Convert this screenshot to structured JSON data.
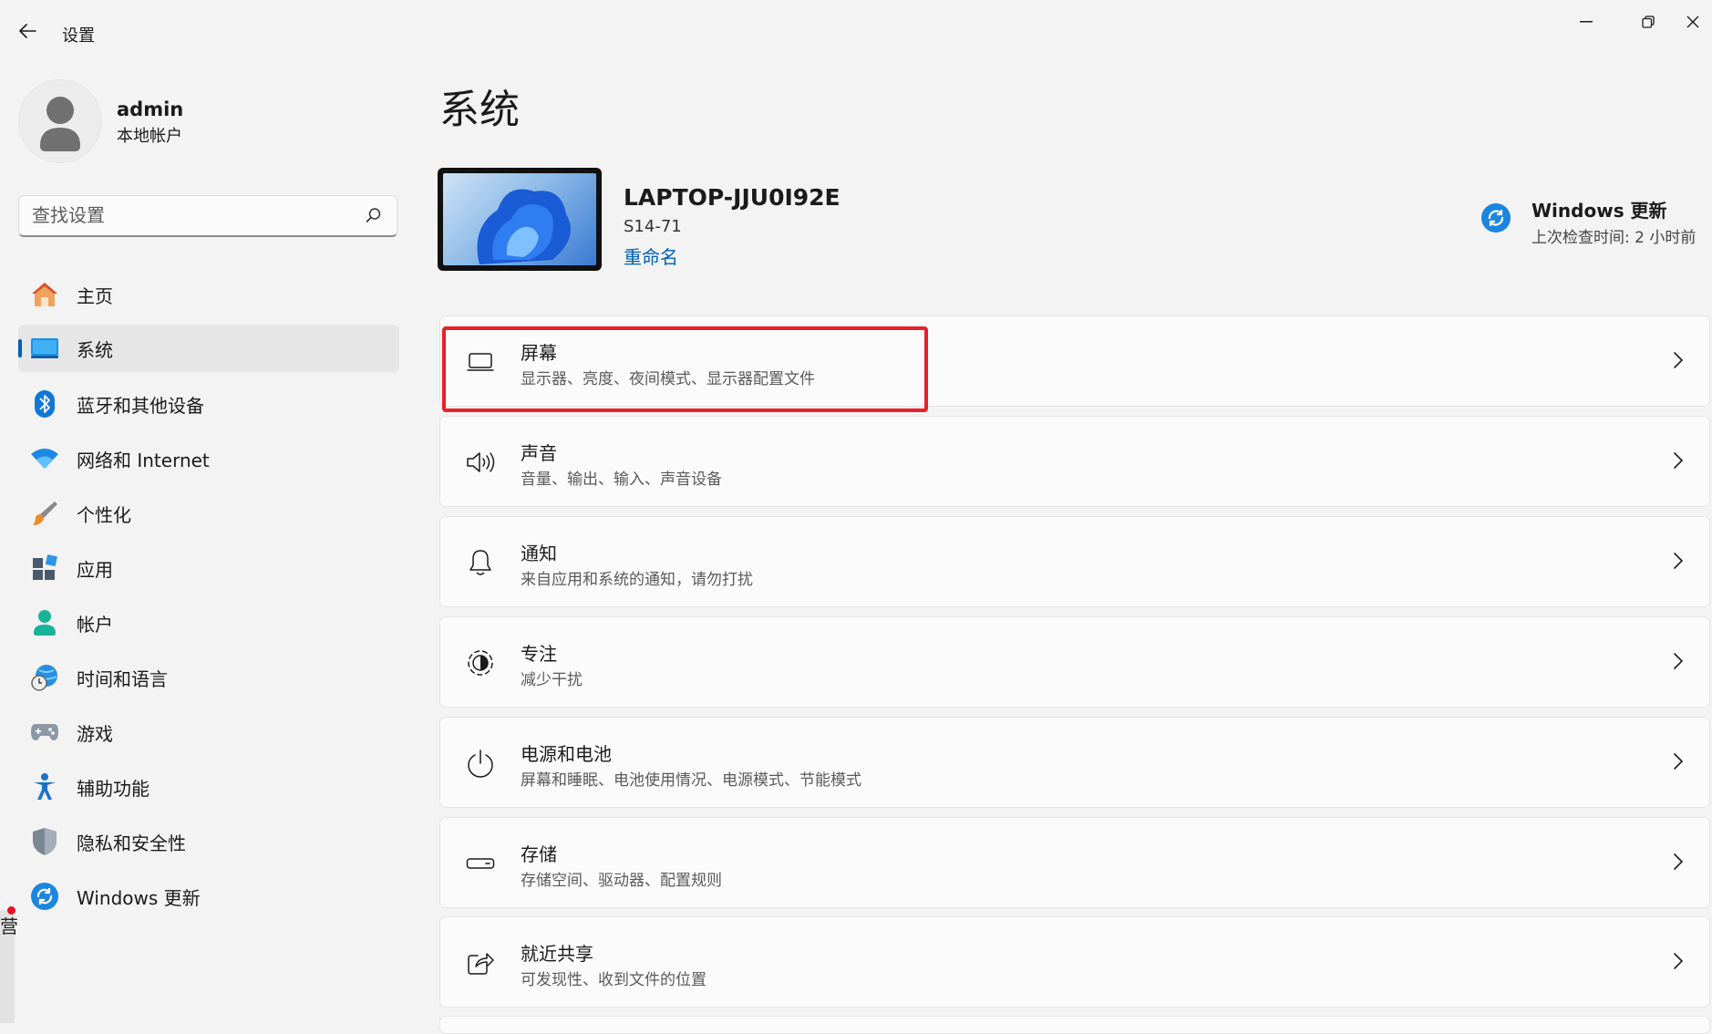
{
  "window": {
    "title": "设置",
    "controls": [
      "minimize-icon",
      "restore-icon",
      "close-icon"
    ]
  },
  "account": {
    "name": "admin",
    "type": "本地帐户"
  },
  "search": {
    "placeholder": "查找设置"
  },
  "sidebar": {
    "items": [
      {
        "label": "主页",
        "icon": "home-icon",
        "active": false
      },
      {
        "label": "系统",
        "icon": "system-icon",
        "active": true
      },
      {
        "label": "蓝牙和其他设备",
        "icon": "bluetooth-icon",
        "active": false
      },
      {
        "label": "网络和 Internet",
        "icon": "wifi-icon",
        "active": false
      },
      {
        "label": "个性化",
        "icon": "brush-icon",
        "active": false
      },
      {
        "label": "应用",
        "icon": "apps-icon",
        "active": false
      },
      {
        "label": "帐户",
        "icon": "account-icon",
        "active": false
      },
      {
        "label": "时间和语言",
        "icon": "time-language-icon",
        "active": false
      },
      {
        "label": "游戏",
        "icon": "gamepad-icon",
        "active": false
      },
      {
        "label": "辅助功能",
        "icon": "accessibility-icon",
        "active": false
      },
      {
        "label": "隐私和安全性",
        "icon": "shield-icon",
        "active": false
      },
      {
        "label": "Windows 更新",
        "icon": "windows-update-icon",
        "active": false
      }
    ]
  },
  "main": {
    "title": "系统",
    "device": {
      "name": "LAPTOP-JJU0I92E",
      "model": "S14-71",
      "rename": "重命名"
    },
    "update": {
      "title": "Windows 更新",
      "subtitle": "上次检查时间: 2 小时前"
    },
    "cards": [
      {
        "title": "屏幕",
        "subtitle": "显示器、亮度、夜间模式、显示器配置文件",
        "icon": "display-icon",
        "highlighted": true
      },
      {
        "title": "声音",
        "subtitle": "音量、输出、输入、声音设备",
        "icon": "speaker-icon",
        "highlighted": false
      },
      {
        "title": "通知",
        "subtitle": "来自应用和系统的通知，请勿打扰",
        "icon": "bell-icon",
        "highlighted": false
      },
      {
        "title": "专注",
        "subtitle": "减少干扰",
        "icon": "focus-icon",
        "highlighted": false
      },
      {
        "title": "电源和电池",
        "subtitle": "屏幕和睡眠、电池使用情况、电源模式、节能模式",
        "icon": "power-icon",
        "highlighted": false
      },
      {
        "title": "存储",
        "subtitle": "存储空间、驱动器、配置规则",
        "icon": "storage-icon",
        "highlighted": false
      },
      {
        "title": "就近共享",
        "subtitle": "可发现性、收到文件的位置",
        "icon": "share-icon",
        "highlighted": false
      }
    ]
  },
  "edge": {
    "glyph": "营"
  },
  "colors": {
    "accent": "#005fb8",
    "highlight_box": "#e8202a",
    "notification_dot": "#e81123"
  }
}
